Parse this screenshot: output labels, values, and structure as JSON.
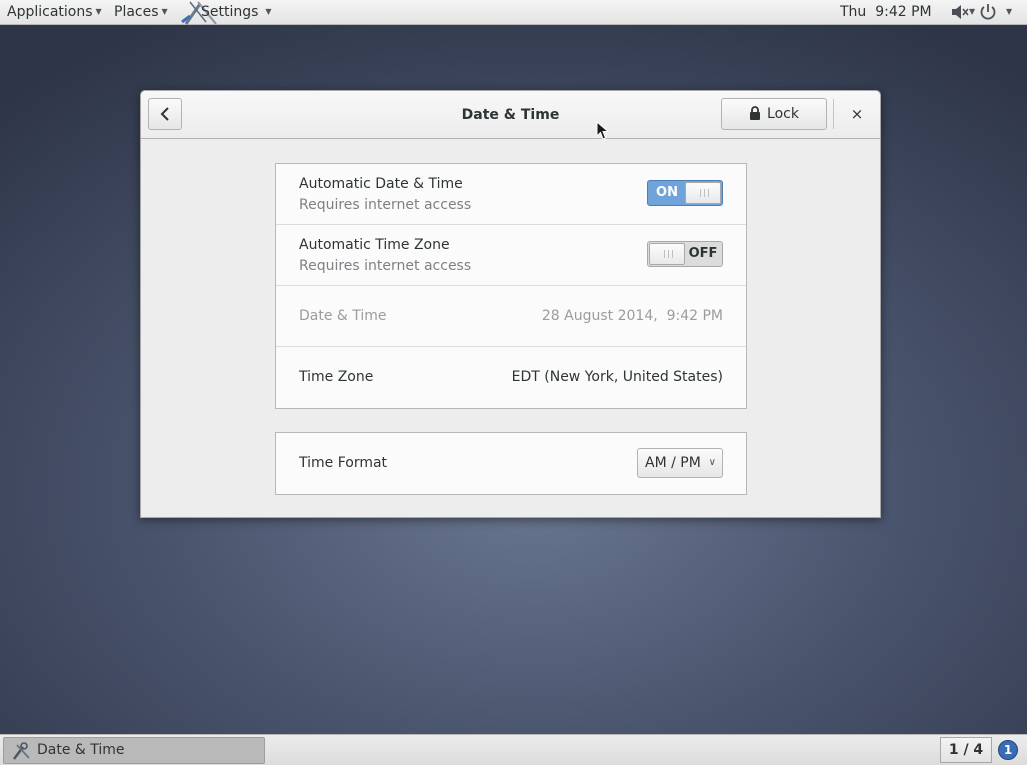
{
  "topbar": {
    "applications": "Applications",
    "places": "Places",
    "settings": "Settings",
    "clock": "Thu  9:42 PM",
    "icons": [
      "speaker-icon",
      "power-icon"
    ]
  },
  "window": {
    "title": "Date & Time",
    "lock_label": "Lock",
    "close_glyph": "×"
  },
  "settings_list": {
    "auto_datetime": {
      "title": "Automatic Date & Time",
      "subtitle": "Requires internet access",
      "state": "ON"
    },
    "auto_timezone": {
      "title": "Automatic Time Zone",
      "subtitle": "Requires internet access",
      "state": "OFF"
    },
    "datetime": {
      "label": "Date & Time",
      "value": "28 August 2014,  9:42 PM"
    },
    "timezone": {
      "label": "Time Zone",
      "value": "EDT (New York, United States)"
    }
  },
  "format_list": {
    "time_format": {
      "label": "Time Format",
      "value": "AM / PM"
    }
  },
  "taskbar": {
    "task_label": "Date & Time",
    "pager": "1 / 4",
    "notifications": "1"
  },
  "colors": {
    "accent": "#6fa3da",
    "notification": "#3a6bb5"
  }
}
